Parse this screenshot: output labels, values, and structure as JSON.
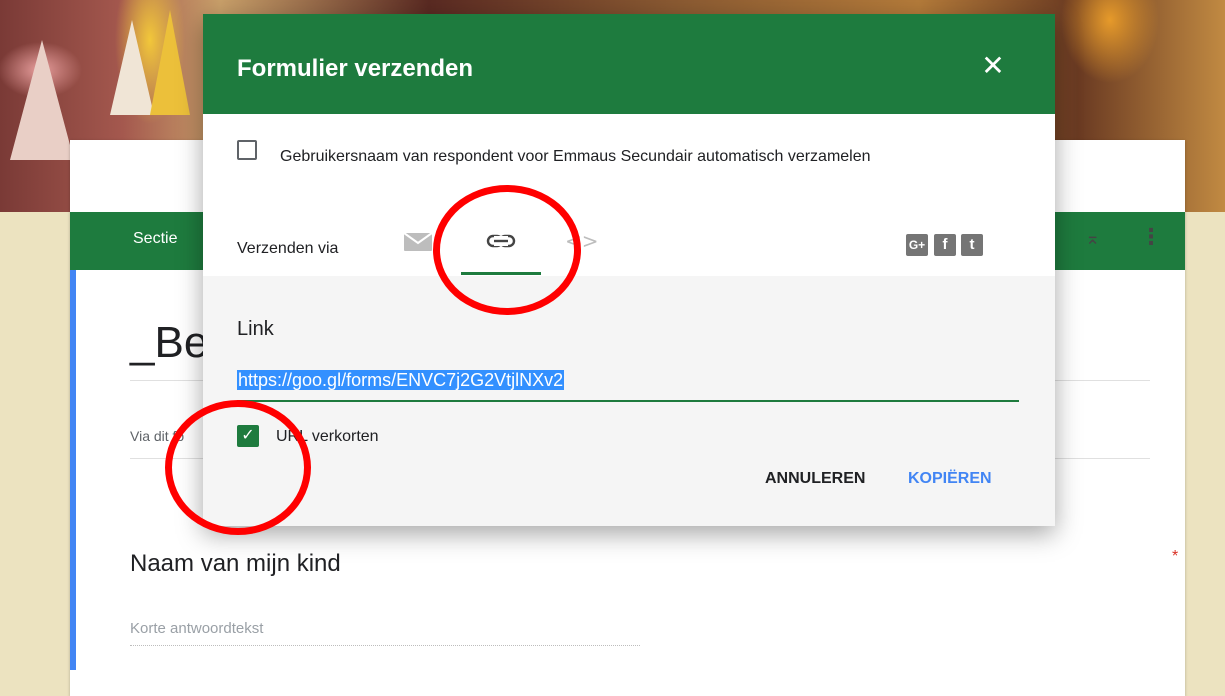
{
  "background": {
    "section_label": "Sectie",
    "form_title": "_Be",
    "description": "Via dit fo",
    "question_title": "Naam van mijn kind",
    "required_marker": "*",
    "answer_placeholder": "Korte antwoordtekst"
  },
  "dialog": {
    "title": "Formulier verzenden",
    "close_icon": "close-icon",
    "collect_username": {
      "label": "Gebruikersnaam van respondent voor Emmaus Secundair automatisch verzamelen",
      "checked": false
    },
    "send_via": {
      "label": "Verzenden via",
      "tabs": [
        {
          "icon": "email-icon",
          "active": false
        },
        {
          "icon": "link-icon",
          "active": true
        },
        {
          "icon": "embed-code-icon",
          "active": false
        }
      ],
      "embed_glyph": "<>"
    },
    "social": [
      {
        "icon": "google-plus-icon",
        "glyph": "G+"
      },
      {
        "icon": "facebook-icon",
        "glyph": "f"
      },
      {
        "icon": "twitter-icon",
        "glyph": "t"
      }
    ],
    "link": {
      "heading": "Link",
      "url": "https://goo.gl/forms/ENVC7j2G2VtjlNXv2"
    },
    "shorten_url": {
      "label": "URL verkorten",
      "checked": true
    },
    "buttons": {
      "cancel": "ANNULEREN",
      "copy": "KOPIËREN"
    }
  },
  "colors": {
    "header_green": "#1e7b3e",
    "link_blue": "#4285f4",
    "annotation_red": "#ff0000"
  }
}
